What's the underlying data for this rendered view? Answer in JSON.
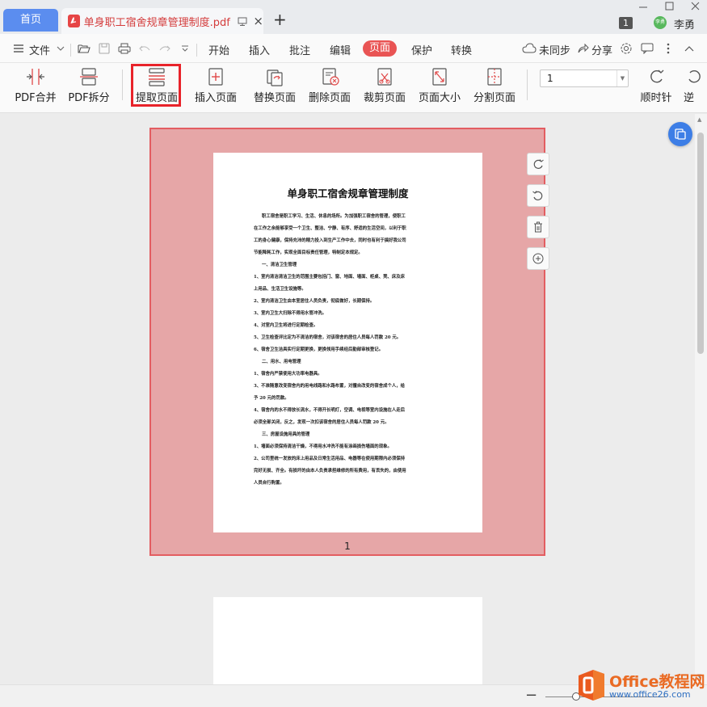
{
  "titlebar": {
    "home_tab": "首页",
    "doc_tab": "单身职工宿舍规章管理制度.pdf",
    "badge": "1",
    "avatar_text": "李勇",
    "username": "李勇"
  },
  "menu": {
    "file": "文件",
    "items": [
      "开始",
      "插入",
      "批注",
      "编辑",
      "页面",
      "保护",
      "转换"
    ],
    "active": "页面",
    "sync": "未同步",
    "share": "分享"
  },
  "toolbar": {
    "pdf_merge": "PDF合并",
    "pdf_split": "PDF拆分",
    "extract": "提取页面",
    "insert": "插入页面",
    "replace": "替换页面",
    "delete": "删除页面",
    "crop": "裁剪页面",
    "size": "页面大小",
    "split": "分割页面",
    "page_value": "1",
    "clockwise": "顺时针",
    "counter": "逆"
  },
  "document": {
    "title": "单身职工宿舍规章管理制度",
    "lines": [
      "职工宿舍是职工学习、生活、休息的场所。为加强职工宿舍的管理，使职工",
      "在工作之余能够享受一个卫生、整洁、宁静、有序、舒适的生活空间，以利于职",
      "工的身心健康，保持充沛的精力投入到生产工作中去，同时也有利于搞好我公司",
      "节能降耗工作，实现全面目标责任管理，特制定本规定。",
      "一、清洁卫生管理",
      "1、室内清洁清洁卫生的范围主要包括门、窗、地面、墙面、柜桌、凳、床及床",
      "上用品、生活卫生设施等。",
      "2、室内清洁卫生由本室居住人员负责，彻底做好，长期保持。",
      "3、室内卫生大扫除不得用水管冲洗。",
      "4、对室内卫生将进行定期检查。",
      "5、卫生检查评比定为不清洁的宿舍，对该宿舍的居住人员每人罚款 20 元。",
      "6、宿舍卫生洁具实行定期更换，更换领用手续经后勤部审核登记。",
      "二、用水、用电管理",
      "1、宿舍内严禁使用大功率电器具。",
      "3、不准随意改变宿舍内的用电线路和水路布置，对擅自改变的宿舍成个人，给",
      "予 20 元的罚款。",
      "4、宿舍内的水不得放长流水，不得开长明灯，空调、电视等室内设施在人走后",
      "必须全部关闭，反之，发现一次扣该宿舍的居住人员每人罚款 20 元。",
      "三、房屋设施用具的管理",
      "1、墙面必须保持清洁干燥，不得用水冲洗不能有涂画损伤墙面的现象。",
      "2、公司里统一发放的床上用品及日常生活用品、电器等在使用期限内必须保持",
      "完好无损、齐全。有损坏的由本人负责承担维修的所有费用，有丢失的，由使用",
      "人员自行购置。"
    ],
    "page_number": "1"
  },
  "watermark": {
    "brand": "Office教程网",
    "url": "www.office26.com"
  }
}
